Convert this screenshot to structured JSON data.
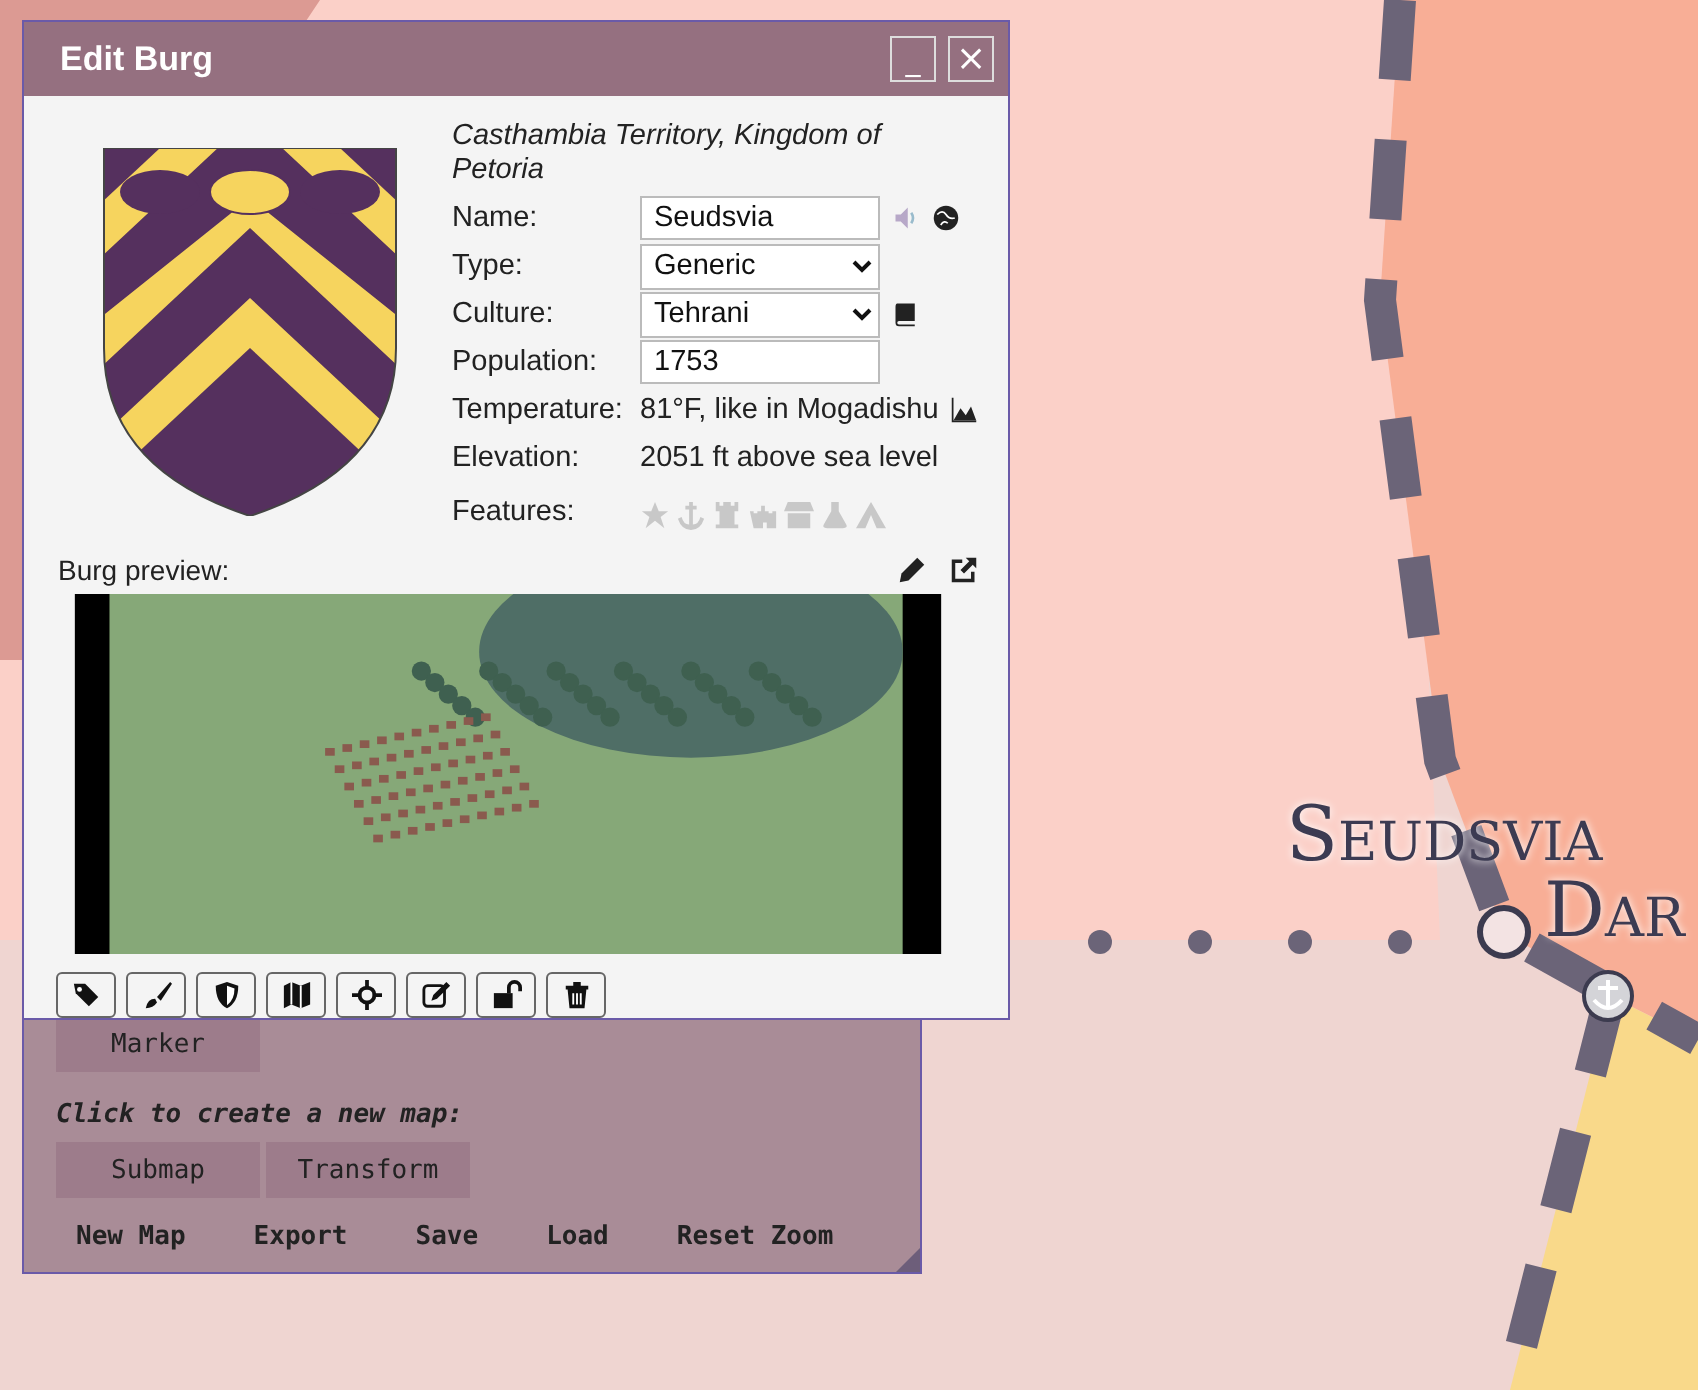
{
  "map": {
    "labels": [
      {
        "text": "Seudsvia",
        "kind": "line1"
      },
      {
        "text": "Dar",
        "kind": "line2"
      }
    ]
  },
  "menu_panel": {
    "tool_buttons": [
      {
        "label": "Marker"
      }
    ],
    "section_title": "Click to create a new map:",
    "new_map_buttons": [
      {
        "label": "Submap"
      },
      {
        "label": "Transform"
      }
    ],
    "footer_links": [
      "New Map",
      "Export",
      "Save",
      "Load",
      "Reset Zoom"
    ]
  },
  "dialog": {
    "title": "Edit Burg",
    "window_buttons": [
      {
        "kind": "minimize",
        "label": "_"
      },
      {
        "kind": "close",
        "label": "×"
      }
    ],
    "location": "Casthambia Territory, Kingdom of Petoria",
    "fields": [
      {
        "kind": "input",
        "label": "Name:",
        "value": "Seudsvia"
      },
      {
        "kind": "select",
        "label": "Type:",
        "value": "Generic"
      },
      {
        "kind": "select",
        "label": "Culture:",
        "value": "Tehrani"
      },
      {
        "kind": "input",
        "label": "Population:",
        "value": "1753"
      },
      {
        "kind": "text",
        "label": "Temperature:",
        "value": "81°F, like in Mogadishu"
      },
      {
        "kind": "text",
        "label": "Elevation:",
        "value": "2051 ft above sea level"
      },
      {
        "kind": "features",
        "label": "Features:"
      }
    ],
    "features": [
      {
        "kind": "capital",
        "on": false
      },
      {
        "kind": "port",
        "on": false
      },
      {
        "kind": "citadel",
        "on": false
      },
      {
        "kind": "walls",
        "on": false
      },
      {
        "kind": "plaza",
        "on": false
      },
      {
        "kind": "temple",
        "on": false
      },
      {
        "kind": "shanty",
        "on": false
      }
    ],
    "preview_label": "Burg preview:"
  }
}
